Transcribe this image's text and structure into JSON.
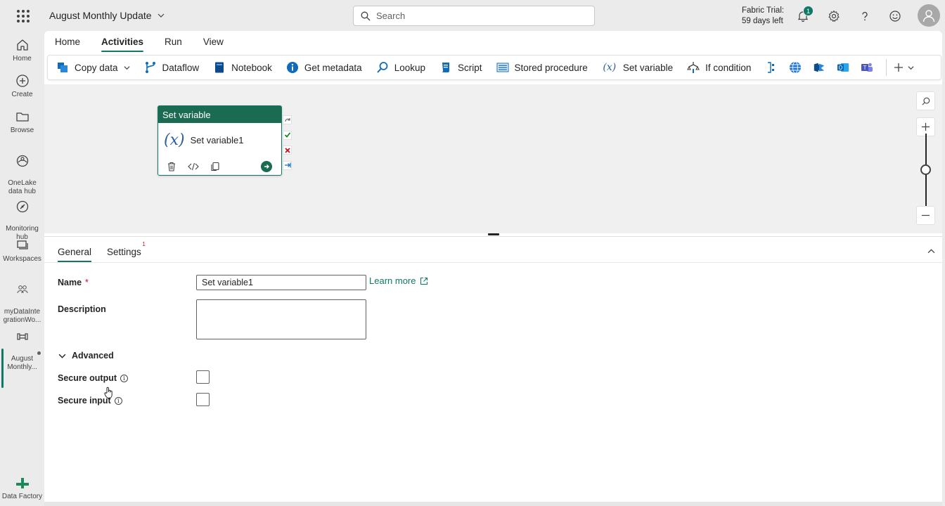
{
  "topbar": {
    "workspace_title": "August Monthly Update",
    "search_placeholder": "Search",
    "trial_line1": "Fabric Trial:",
    "trial_line2": "59 days left",
    "notification_count": "1"
  },
  "rail": {
    "items": [
      {
        "label": "Home"
      },
      {
        "label": "Create"
      },
      {
        "label": "Browse"
      },
      {
        "label": "OneLake\ndata hub"
      },
      {
        "label": "Monitoring\nhub"
      },
      {
        "label": "Workspaces"
      },
      {
        "label": "myDataInte\ngrationWo..."
      },
      {
        "label": "August\nMonthly..."
      }
    ],
    "footer_label": "Data Factory"
  },
  "menu": {
    "tabs": [
      "Home",
      "Activities",
      "Run",
      "View"
    ],
    "active": "Activities"
  },
  "ribbon": {
    "items": [
      {
        "label": "Copy data"
      },
      {
        "label": "Dataflow"
      },
      {
        "label": "Notebook"
      },
      {
        "label": "Get metadata"
      },
      {
        "label": "Lookup"
      },
      {
        "label": "Script"
      },
      {
        "label": "Stored procedure"
      },
      {
        "label": "Set variable"
      },
      {
        "label": "If condition"
      }
    ]
  },
  "canvas": {
    "node": {
      "type_label": "Set variable",
      "name": "Set variable1",
      "symbol": "(x)"
    }
  },
  "panel": {
    "tabs": [
      {
        "label": "General",
        "badge": ""
      },
      {
        "label": "Settings",
        "badge": "1"
      }
    ],
    "active_tab": "General",
    "name_label": "Name",
    "name_required": "*",
    "name_value": "Set variable1",
    "learn_more": "Learn more",
    "description_label": "Description",
    "advanced_label": "Advanced",
    "secure_output_label": "Secure output",
    "secure_input_label": "Secure input"
  },
  "colors": {
    "accent": "#117865",
    "node_header": "#1b6b52",
    "required": "#c50f1f"
  }
}
